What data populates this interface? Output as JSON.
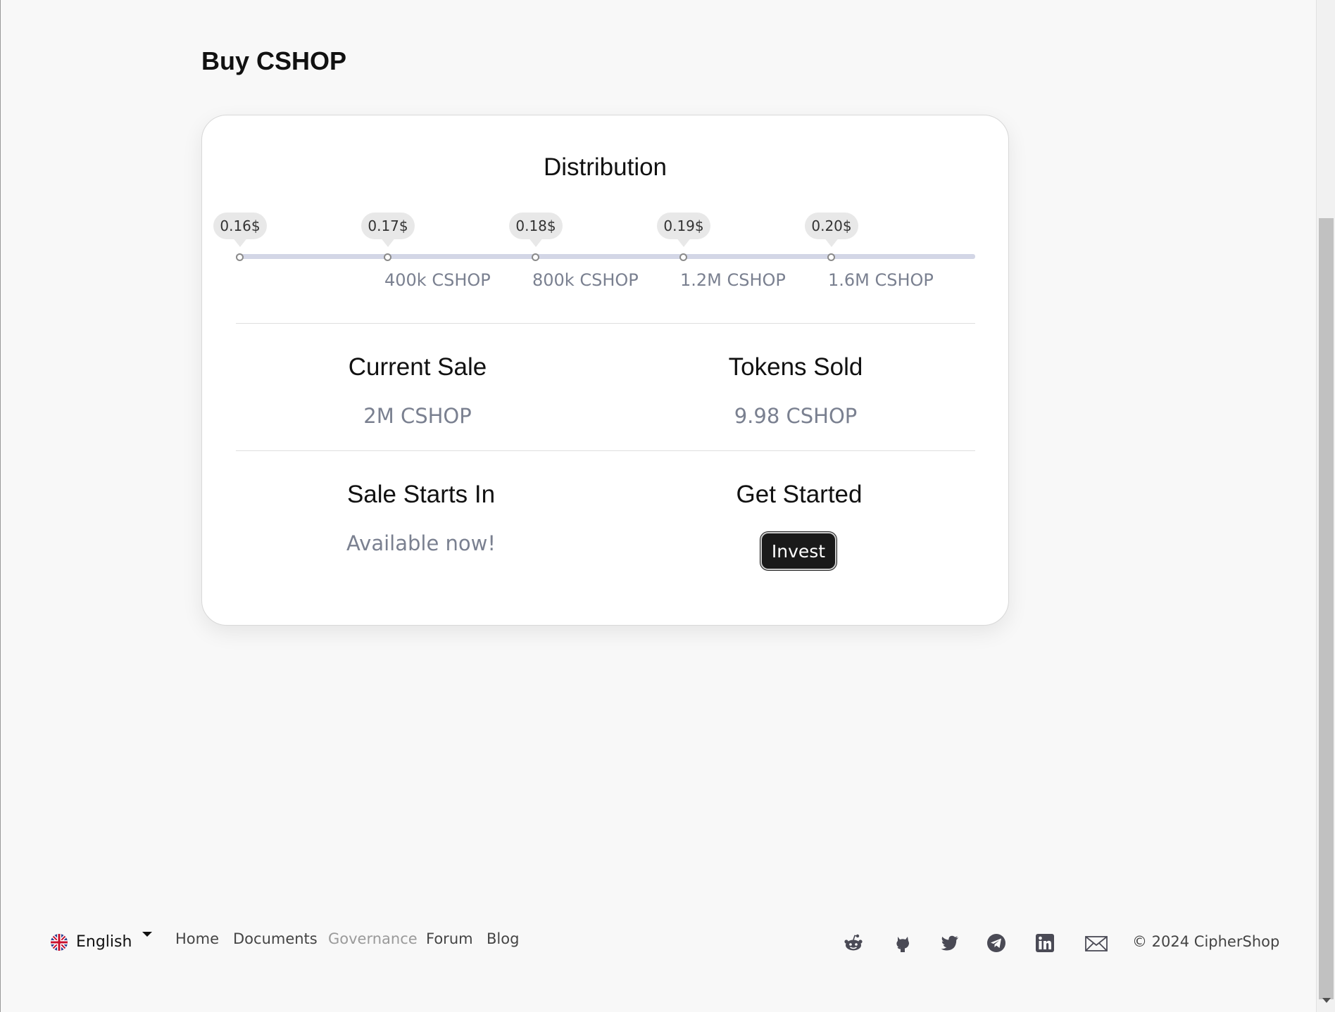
{
  "page": {
    "title": "Buy CSHOP"
  },
  "card": {
    "distribution_title": "Distribution",
    "prices": [
      "0.16$",
      "0.17$",
      "0.18$",
      "0.19$",
      "0.20$"
    ],
    "milestones": [
      "400k CSHOP",
      "800k CSHOP",
      "1.2M CSHOP",
      "1.6M CSHOP"
    ],
    "current_sale": {
      "label": "Current Sale",
      "value": "2M CSHOP"
    },
    "tokens_sold": {
      "label": "Tokens Sold",
      "value": "9.98 CSHOP"
    },
    "sale_starts": {
      "label": "Sale Starts In",
      "value": "Available now!"
    },
    "get_started": {
      "label": "Get Started",
      "button": "Invest"
    }
  },
  "footer": {
    "language": "English",
    "nav": [
      {
        "label": "Home"
      },
      {
        "label": "Documents"
      },
      {
        "label": "Governance"
      },
      {
        "label": "Forum"
      },
      {
        "label": "Blog"
      }
    ],
    "social_icons": [
      "reddit-icon",
      "github-icon",
      "twitter-icon",
      "telegram-icon",
      "linkedin-icon",
      "mail-icon"
    ],
    "copyright": "© 2024 CipherShop"
  },
  "colors": {
    "accent": "#1a1a1a",
    "track": "#d3d6e6",
    "muted_text": "#7a8090"
  }
}
